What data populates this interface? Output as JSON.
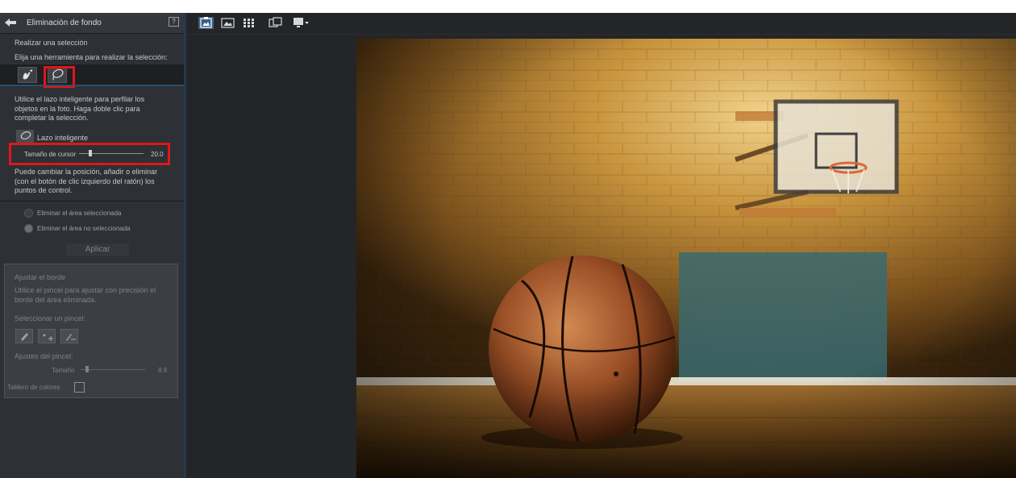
{
  "panel": {
    "title": "Eliminación de fondo",
    "help_glyph": "?",
    "section_label": "Realizar una selección",
    "instruction": "Elija una herramienta para realizar la selección:",
    "tools": [
      {
        "name": "brush-selection-tool",
        "icon": "hand-brush-icon",
        "active": false
      },
      {
        "name": "smart-lasso-tool",
        "icon": "lasso-icon",
        "active": true
      }
    ],
    "lasso_description": [
      "Utilice el lazo inteligente para perfilar los",
      "objetos en la foto. Haga doble clic para",
      "completar la selección."
    ],
    "lasso_label": "Lazo inteligente",
    "cursor_size_label": "Tamaño de cursor",
    "cursor_size_value": "20.0",
    "cursor_size_fraction": 0.18,
    "control_points_help": [
      "Puede cambiar la posición, añadir o eliminar",
      "(con el botón de clic izquierdo del ratón) los",
      "puntos de control."
    ],
    "options": [
      {
        "label": "Eliminar el área seleccionada",
        "checked": false
      },
      {
        "label": "Eliminar el área no seleccionada",
        "checked": true
      }
    ],
    "apply_label": "Aplicar",
    "edge": {
      "title": "Ajustar el borde",
      "description": [
        "Utilice el pincel para ajustar con precisión el",
        "borde del área eliminada."
      ],
      "select_brush_label": "Seleccionar un pincel:",
      "brushes": [
        "eraser-brush-icon",
        "add-brush-icon",
        "subtract-brush-icon"
      ],
      "brush_settings_label": "Ajustes del pincel:",
      "size_label": "Tamaño",
      "size_value": "8.9",
      "size_fraction": 0.1,
      "checkerboard_label": "Tablero de colores"
    }
  },
  "view_toolbar": {
    "buttons": [
      "edit-view-icon",
      "single-view-icon",
      "grid-view-icon",
      "compare-view-icon",
      "display-menu-icon"
    ]
  },
  "colors": {
    "accent_red": "#e0161b",
    "panel_bg": "#2d3034",
    "active_tool": "#3c3f43"
  }
}
